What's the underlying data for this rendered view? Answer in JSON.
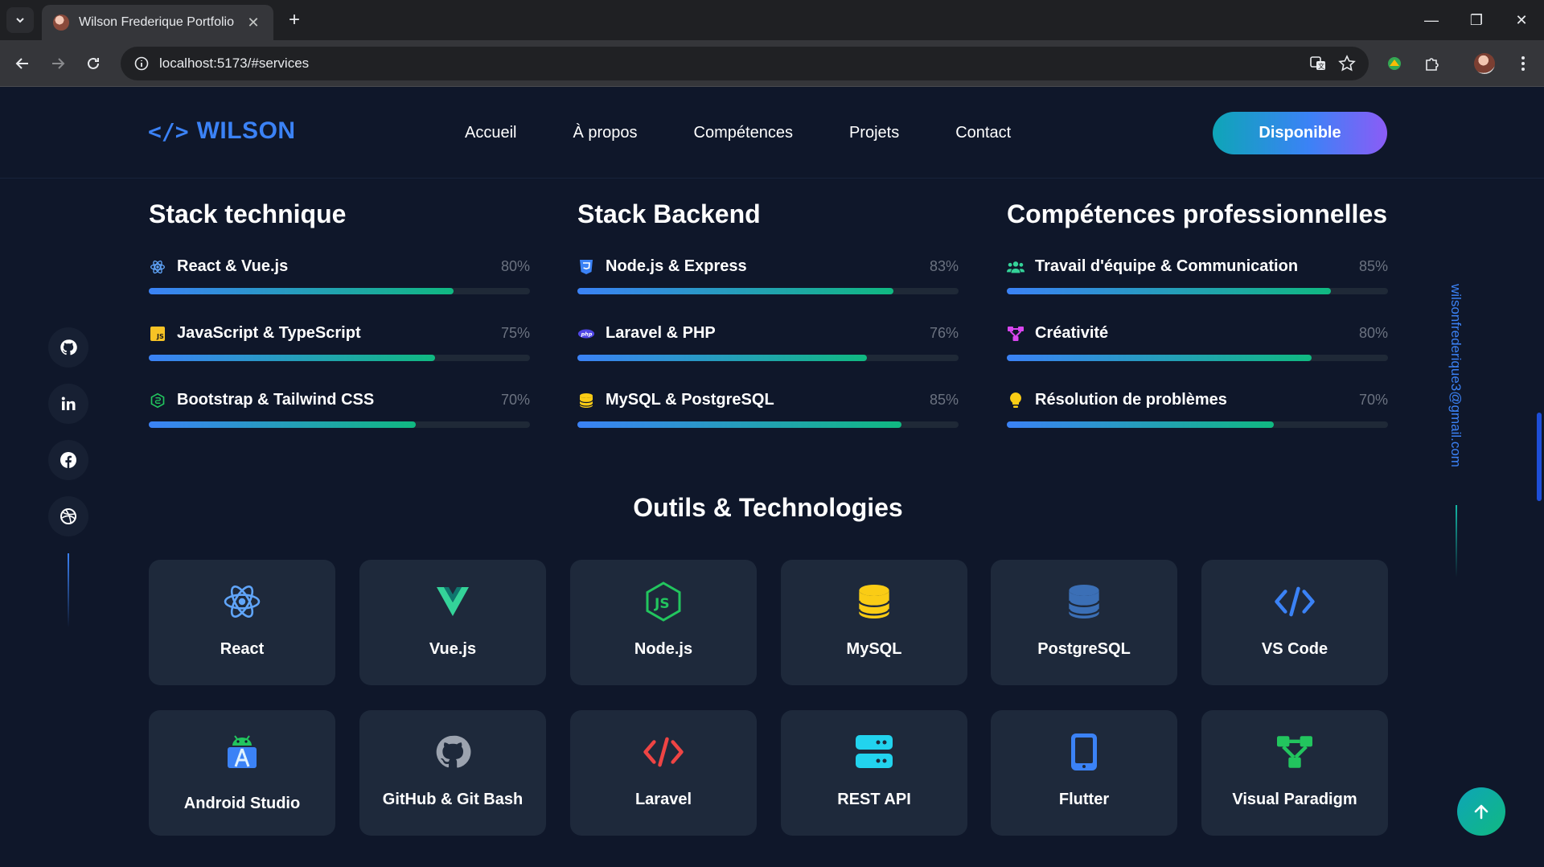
{
  "browser": {
    "tab_title": "Wilson Frederique Portfolio",
    "url": "localhost:5173/#services"
  },
  "header": {
    "logo_icon": "</>",
    "logo_text": "WILSON",
    "nav": [
      "Accueil",
      "À propos",
      "Compétences",
      "Projets",
      "Contact"
    ],
    "cta": "Disponible"
  },
  "sidebar": {
    "social": [
      "github-icon",
      "linkedin-icon",
      "facebook-icon",
      "dribbble-icon"
    ],
    "email": "wilsonfrederique3@gmail.com"
  },
  "columns": [
    {
      "title": "Stack technique",
      "skills": [
        {
          "name": "React & Vue.js",
          "percent": "80%",
          "level": 80,
          "icon": "react-icon"
        },
        {
          "name": "JavaScript & TypeScript",
          "percent": "75%",
          "level": 75,
          "icon": "js-icon"
        },
        {
          "name": "Bootstrap & Tailwind CSS",
          "percent": "70%",
          "level": 70,
          "icon": "node-hex-icon"
        }
      ]
    },
    {
      "title": "Stack Backend",
      "skills": [
        {
          "name": "Node.js & Express",
          "percent": "83%",
          "level": 83,
          "icon": "css-shield-icon"
        },
        {
          "name": "Laravel & PHP",
          "percent": "76%",
          "level": 76,
          "icon": "php-icon"
        },
        {
          "name": "MySQL & PostgreSQL",
          "percent": "85%",
          "level": 85,
          "icon": "database-icon"
        }
      ]
    },
    {
      "title": "Compétences professionnelles",
      "skills": [
        {
          "name": "Travail d'équipe & Communication",
          "percent": "85%",
          "level": 85,
          "icon": "users-icon"
        },
        {
          "name": "Créativité",
          "percent": "80%",
          "level": 80,
          "icon": "diagram-icon"
        },
        {
          "name": "Résolution de problèmes",
          "percent": "70%",
          "level": 70,
          "icon": "lightbulb-icon"
        }
      ]
    }
  ],
  "tools": {
    "title": "Outils & Technologies",
    "items": [
      {
        "name": "React",
        "icon": "react-icon"
      },
      {
        "name": "Vue.js",
        "icon": "vue-icon"
      },
      {
        "name": "Node.js",
        "icon": "nodejs-icon"
      },
      {
        "name": "MySQL",
        "icon": "database-icon"
      },
      {
        "name": "PostgreSQL",
        "icon": "database-icon"
      },
      {
        "name": "VS Code",
        "icon": "code-icon"
      },
      {
        "name": "Android Studio",
        "icon": "android-icon"
      },
      {
        "name": "GitHub & Git Bash",
        "icon": "github-icon"
      },
      {
        "name": "Laravel",
        "icon": "code-icon"
      },
      {
        "name": "REST API",
        "icon": "server-icon"
      },
      {
        "name": "Flutter",
        "icon": "mobile-icon"
      },
      {
        "name": "Visual Paradigm",
        "icon": "diagram-icon"
      }
    ]
  },
  "colors": {
    "background": "#0f172a",
    "card": "#1e293b",
    "accent_blue": "#3b82f6",
    "accent_green": "#10b981"
  }
}
